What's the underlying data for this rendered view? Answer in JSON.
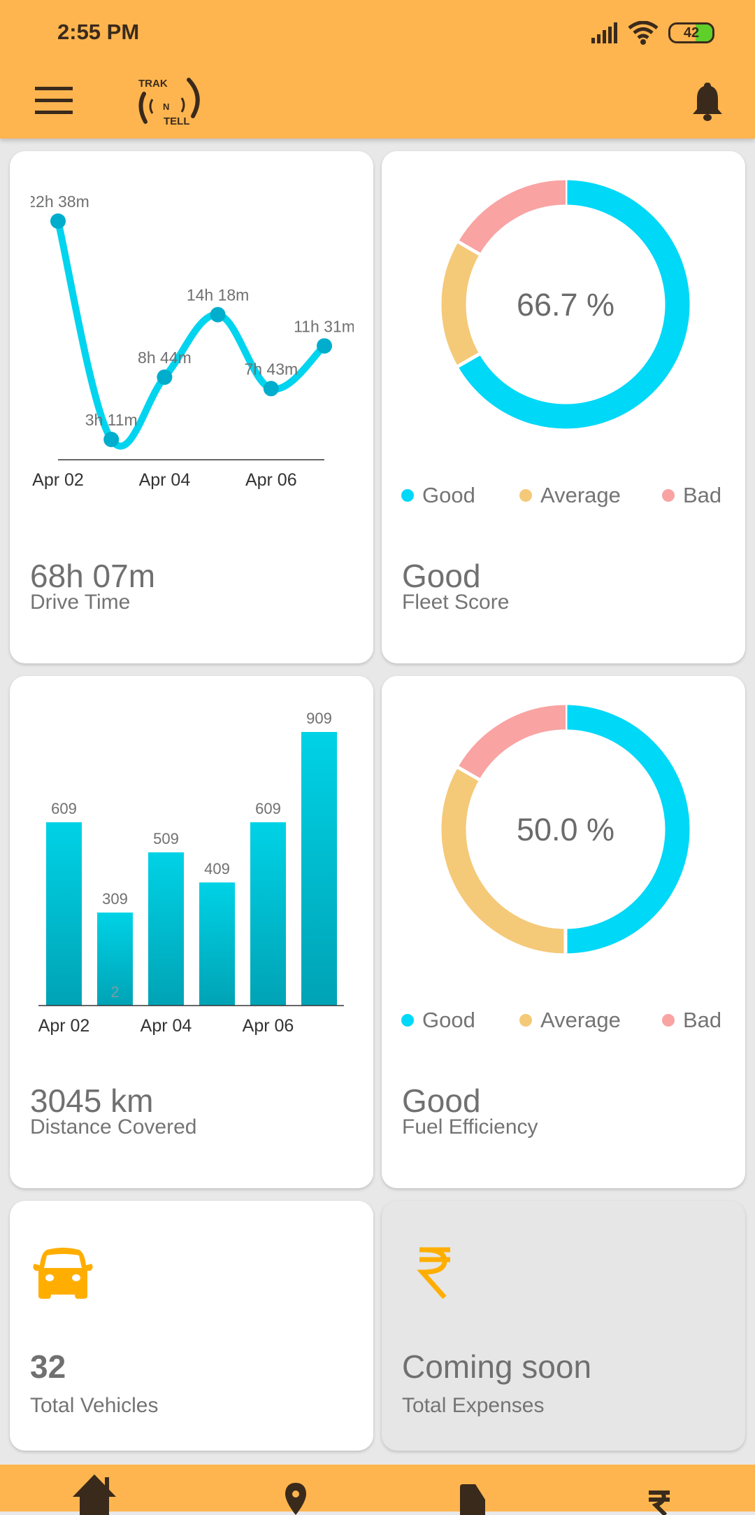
{
  "status_bar": {
    "time": "2:55 PM",
    "battery": "42"
  },
  "header": {
    "logo_text": {
      "top": "TRAK",
      "middle": "N",
      "bottom": "TELL"
    },
    "menu_icon": "hamburger-icon",
    "notification_icon": "bell-icon"
  },
  "cards": {
    "drive_time": {
      "value": "68h 07m",
      "label": "Drive Time"
    },
    "fleet_score": {
      "center_text": "66.7 %",
      "value": "Good",
      "label": "Fleet Score"
    },
    "distance": {
      "value": "3045 km",
      "label": "Distance Covered",
      "inner_label": "2"
    },
    "fuel_efficiency": {
      "center_text": "50.0 %",
      "value": "Good",
      "label": "Fuel Efficiency"
    },
    "vehicles": {
      "value": "32",
      "label": "Total Vehicles",
      "icon": "car-icon"
    },
    "expenses": {
      "value": "Coming soon",
      "label": "Total Expenses",
      "icon": "rupee-icon"
    }
  },
  "legend": [
    {
      "name": "Good",
      "color": "#00d8f8"
    },
    {
      "name": "Average",
      "color": "#f4c978"
    },
    {
      "name": "Bad",
      "color": "#f9a3a3"
    }
  ],
  "bottom_nav": [
    {
      "icon": "home-icon"
    },
    {
      "icon": "location-icon"
    },
    {
      "icon": "fuel-icon"
    },
    {
      "icon": "rupee-icon"
    }
  ],
  "colors": {
    "brand": "#ffb54f",
    "line": "#00d4ee",
    "point": "#00adcc",
    "bar_top": "#00d2e6",
    "bar_bottom": "#00a3b5"
  },
  "chart_data": [
    {
      "type": "line",
      "x_tick_labels": [
        "Apr 02",
        "Apr 04",
        "Apr 06"
      ],
      "values_minutes": [
        1358,
        191,
        524,
        858,
        463,
        691
      ],
      "data_labels": [
        "22h 38m",
        "3h 11m",
        "8h 44m",
        "14h 18m",
        "7h 43m",
        "11h 31m"
      ],
      "grid": false
    },
    {
      "type": "pie",
      "donut": true,
      "categories": [
        "Good",
        "Average",
        "Bad"
      ],
      "values": [
        66.7,
        16.7,
        16.6
      ],
      "center_label": "66.7 %",
      "legend": "bottom"
    },
    {
      "type": "bar",
      "x_tick_labels": [
        "Apr 02",
        "Apr 04",
        "Apr 06"
      ],
      "values": [
        609,
        309,
        509,
        409,
        609,
        909
      ],
      "ylim": [
        0,
        909
      ],
      "grid": false
    },
    {
      "type": "pie",
      "donut": true,
      "categories": [
        "Good",
        "Average",
        "Bad"
      ],
      "values": [
        50.0,
        33.3,
        16.7
      ],
      "center_label": "50.0 %",
      "legend": "bottom"
    }
  ]
}
